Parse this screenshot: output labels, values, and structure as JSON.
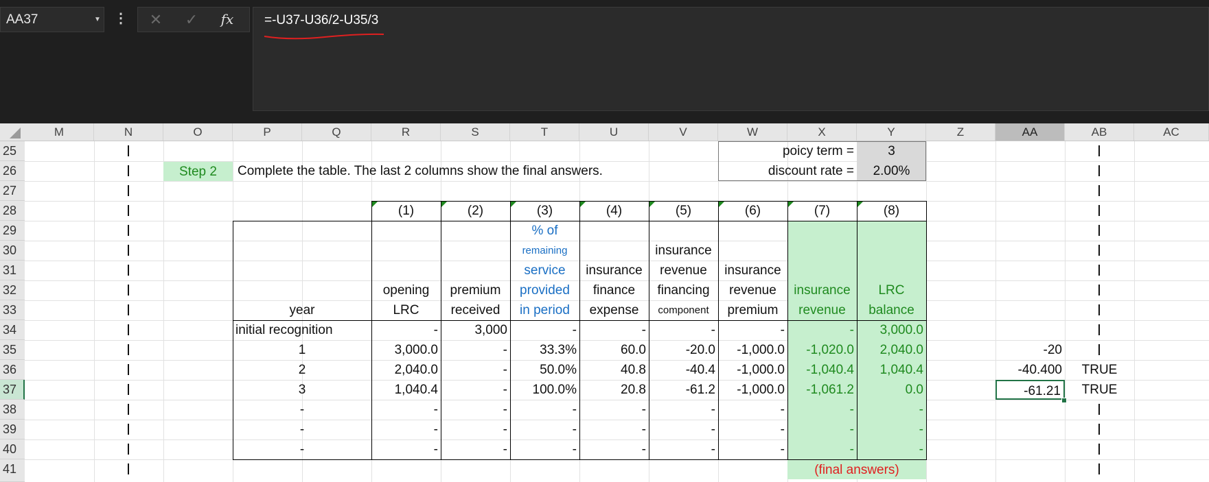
{
  "formula_bar": {
    "name_box": "AA37",
    "formula": "=-U37-U36/2-U35/3",
    "icons": {
      "menu": "more-vertical-icon",
      "cancel": "close-icon",
      "enter": "check-icon",
      "function": "fx-icon"
    }
  },
  "column_headers": [
    "M",
    "N",
    "O",
    "P",
    "Q",
    "R",
    "S",
    "T",
    "U",
    "V",
    "W",
    "X",
    "Y",
    "Z",
    "AA",
    "AB",
    "AC"
  ],
  "selected_column": "AA",
  "row_headers": [
    "25",
    "26",
    "27",
    "28",
    "29",
    "30",
    "31",
    "32",
    "33",
    "34",
    "35",
    "36",
    "37",
    "38",
    "39",
    "40",
    "41"
  ],
  "selected_row": "37",
  "params": {
    "policy_term_label": "poicy term =",
    "policy_term_value": "3",
    "discount_rate_label": "discount rate =",
    "discount_rate_value": "2.00%"
  },
  "step": {
    "badge": "Step 2",
    "instruction": "Complete the table. The last 2 columns show the final answers."
  },
  "table": {
    "col_numbers": [
      "(1)",
      "(2)",
      "(3)",
      "(4)",
      "(5)",
      "(6)",
      "(7)",
      "(8)"
    ],
    "headers": {
      "year": "year",
      "opening_lrc": [
        "opening",
        "LRC"
      ],
      "premium_received": [
        "premium",
        "received"
      ],
      "pct_service": [
        "% of",
        "remaining",
        "service",
        "provided",
        "in period"
      ],
      "finance_expense": [
        "insurance",
        "finance",
        "expense"
      ],
      "rev_financing": [
        "insurance",
        "revenue",
        "financing",
        "component"
      ],
      "revenue_premium": [
        "insurance",
        "revenue",
        "premium"
      ],
      "insurance_revenue": [
        "insurance",
        "revenue"
      ],
      "lrc_balance": [
        "LRC",
        "balance"
      ]
    },
    "rows": [
      [
        "initial recognition",
        "-",
        "3,000",
        "-",
        "-",
        "-",
        "-",
        "-",
        "3,000.0"
      ],
      [
        "1",
        "3,000.0",
        "-",
        "33.3%",
        "60.0",
        "-20.0",
        "-1,000.0",
        "-1,020.0",
        "2,040.0"
      ],
      [
        "2",
        "2,040.0",
        "-",
        "50.0%",
        "40.8",
        "-40.4",
        "-1,000.0",
        "-1,040.4",
        "1,040.4"
      ],
      [
        "3",
        "1,040.4",
        "-",
        "100.0%",
        "20.8",
        "-61.2",
        "-1,000.0",
        "-1,061.2",
        "0.0"
      ],
      [
        "-",
        "-",
        "-",
        "-",
        "-",
        "-",
        "-",
        "-",
        "-"
      ],
      [
        "-",
        "-",
        "-",
        "-",
        "-",
        "-",
        "-",
        "-",
        "-"
      ],
      [
        "-",
        "-",
        "-",
        "-",
        "-",
        "-",
        "-",
        "-",
        "-"
      ]
    ],
    "final_answers_note": "(final answers)"
  },
  "side_checks": {
    "aa35": "-20",
    "aa36": "-40.400",
    "aa37": "-61.21",
    "ab36": "TRUE",
    "ab37": "TRUE"
  },
  "separator_char": "|"
}
